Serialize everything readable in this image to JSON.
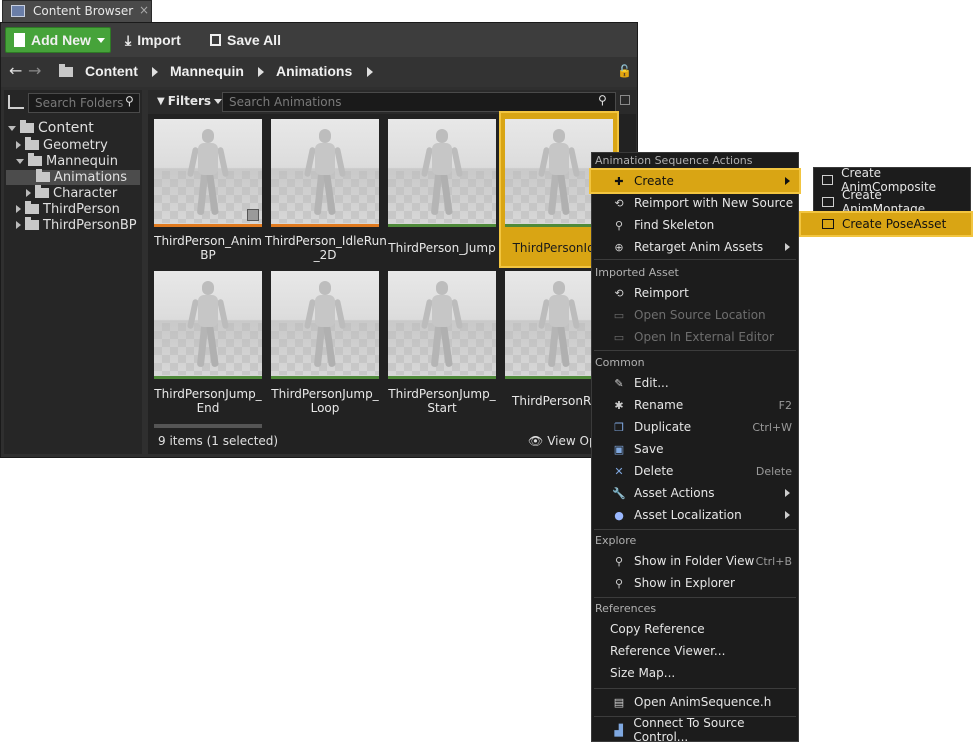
{
  "window": {
    "tab_title": "Content Browser",
    "tab_close": "×"
  },
  "toolbar": {
    "add_new": "Add New",
    "import": "Import",
    "save_all": "Save All"
  },
  "breadcrumb": [
    "Content",
    "Mannequin",
    "Animations"
  ],
  "sidebar": {
    "search_placeholder": "Search Folders",
    "items": [
      {
        "label": "Content"
      },
      {
        "label": "Geometry"
      },
      {
        "label": "Mannequin"
      },
      {
        "label": "Animations"
      },
      {
        "label": "Character"
      },
      {
        "label": "ThirdPerson"
      },
      {
        "label": "ThirdPersonBP"
      }
    ]
  },
  "filters": {
    "label": "Filters",
    "search_placeholder": "Search Animations"
  },
  "assets": [
    {
      "line1": "ThirdPerson_Anim",
      "line2": "BP",
      "bar_color": "#e07a1f"
    },
    {
      "line1": "ThirdPerson_IdleRun",
      "line2": "_2D",
      "bar_color": "#e07a1f"
    },
    {
      "line1": "ThirdPerson_Jump",
      "line2": "",
      "bar_color": "#4f8a3a"
    },
    {
      "line1": "ThirdPersonIdle",
      "line2": "",
      "bar_color": "#4f8a3a"
    },
    {
      "line1": "ThirdPersonJump_",
      "line2": "End",
      "bar_color": "#4f8a3a"
    },
    {
      "line1": "ThirdPersonJump_",
      "line2": "Loop",
      "bar_color": "#4f8a3a"
    },
    {
      "line1": "ThirdPersonJump_",
      "line2": "Start",
      "bar_color": "#4f8a3a"
    },
    {
      "line1": "ThirdPersonRun",
      "line2": "",
      "bar_color": "#4f8a3a"
    }
  ],
  "status": {
    "count": "9 items (1 selected)",
    "view_options": "View Op"
  },
  "context_menu": {
    "sections": [
      {
        "header": "Animation Sequence Actions",
        "items": [
          {
            "label": "Create",
            "shortcut": "",
            "submenu": true,
            "highlighted": true
          },
          {
            "label": "Reimport with New Source",
            "shortcut": ""
          },
          {
            "label": "Find Skeleton",
            "shortcut": ""
          },
          {
            "label": "Retarget Anim Assets",
            "shortcut": "",
            "submenu": true
          }
        ]
      },
      {
        "header": "Imported Asset",
        "items": [
          {
            "label": "Reimport",
            "shortcut": ""
          },
          {
            "label": "Open Source Location",
            "shortcut": "",
            "disabled": true
          },
          {
            "label": "Open In External Editor",
            "shortcut": "",
            "disabled": true
          }
        ]
      },
      {
        "header": "Common",
        "items": [
          {
            "label": "Edit...",
            "shortcut": ""
          },
          {
            "label": "Rename",
            "shortcut": "F2"
          },
          {
            "label": "Duplicate",
            "shortcut": "Ctrl+W"
          },
          {
            "label": "Save",
            "shortcut": ""
          },
          {
            "label": "Delete",
            "shortcut": "Delete"
          },
          {
            "label": "Asset Actions",
            "shortcut": "",
            "submenu": true
          },
          {
            "label": "Asset Localization",
            "shortcut": "",
            "submenu": true
          }
        ]
      },
      {
        "header": "Explore",
        "items": [
          {
            "label": "Show in Folder View",
            "shortcut": "Ctrl+B"
          },
          {
            "label": "Show in Explorer",
            "shortcut": ""
          }
        ]
      },
      {
        "header": "References",
        "items": [
          {
            "label": "Copy Reference",
            "shortcut": ""
          },
          {
            "label": "Reference Viewer...",
            "shortcut": ""
          },
          {
            "label": "Size Map...",
            "shortcut": ""
          }
        ]
      },
      {
        "header": "",
        "items": [
          {
            "label": "Open AnimSequence.h",
            "shortcut": ""
          }
        ]
      },
      {
        "header": "",
        "items": [
          {
            "label": "Connect To Source Control...",
            "shortcut": ""
          }
        ]
      }
    ]
  },
  "create_submenu": {
    "items": [
      {
        "label": "Create AnimComposite"
      },
      {
        "label": "Create AnimMontage"
      },
      {
        "label": "Create PoseAsset",
        "highlighted": true
      }
    ]
  },
  "colors": {
    "accent_gold": "#d9a514",
    "add_new_green": "#46a33a",
    "panel": "#2f2f2f"
  }
}
